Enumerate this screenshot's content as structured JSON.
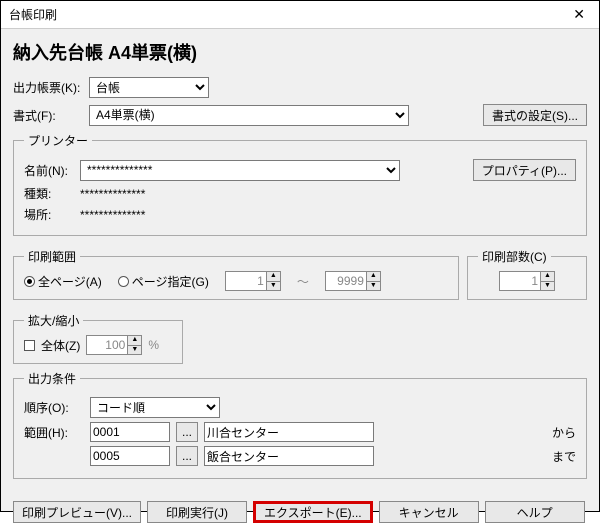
{
  "window": {
    "title": "台帳印刷"
  },
  "main_title": "納入先台帳 A4単票(横)",
  "output_form": {
    "label": "出力帳票(K):",
    "value": "台帳"
  },
  "format": {
    "label": "書式(F):",
    "value": "A4単票(横)",
    "settings_btn": "書式の設定(S)..."
  },
  "printer": {
    "legend": "プリンター",
    "name_label": "名前(N):",
    "name_value": "**************",
    "property_btn": "プロパティ(P)...",
    "kind_label": "種類:",
    "kind_value": "**************",
    "place_label": "場所:",
    "place_value": "**************"
  },
  "print_range": {
    "legend": "印刷範囲",
    "all_label": "全ページ(A)",
    "specify_label": "ページ指定(G)",
    "from": "1",
    "sep": "～",
    "to": "9999"
  },
  "copies": {
    "legend": "印刷部数(C)",
    "value": "1"
  },
  "scale": {
    "legend": "拡大/縮小",
    "whole_label": "全体(Z)",
    "value": "100",
    "unit": "%"
  },
  "conditions": {
    "legend": "出力条件",
    "order_label": "順序(O):",
    "order_value": "コード順",
    "range_label": "範囲(H):",
    "from_code": "0001",
    "to_code": "0005",
    "from_name": "川合センター",
    "to_name": "飯合センター",
    "from_suffix": "から",
    "to_suffix": "まで",
    "ellipsis": "..."
  },
  "buttons": {
    "preview": "印刷プレビュー(V)...",
    "execute": "印刷実行(J)",
    "export": "エクスポート(E)...",
    "cancel": "キャンセル",
    "help": "ヘルプ"
  }
}
